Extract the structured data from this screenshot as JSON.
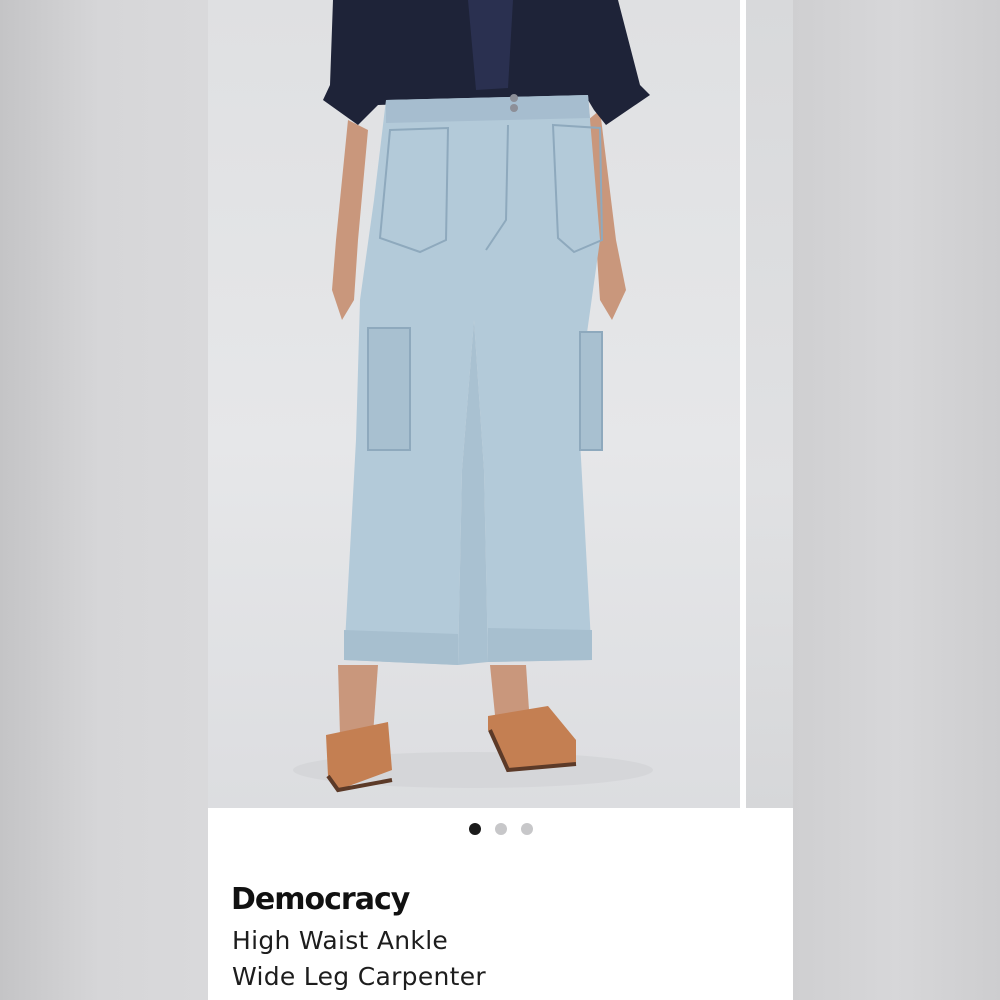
{
  "product": {
    "brand": "Democracy",
    "title_lines": [
      "High Waist Ankle",
      "Wide Leg Carpenter"
    ]
  },
  "carousel": {
    "total_images": 3,
    "active_index": 0,
    "image_alt": "product-photo-light-wash-wide-leg-carpenter-jeans"
  },
  "colors": {
    "active_dot": "#1b1b1b",
    "inactive_dot": "#c7c7c9",
    "denim": "#b3cad9",
    "top": "#1e2338",
    "sandal": "#c47f52"
  }
}
